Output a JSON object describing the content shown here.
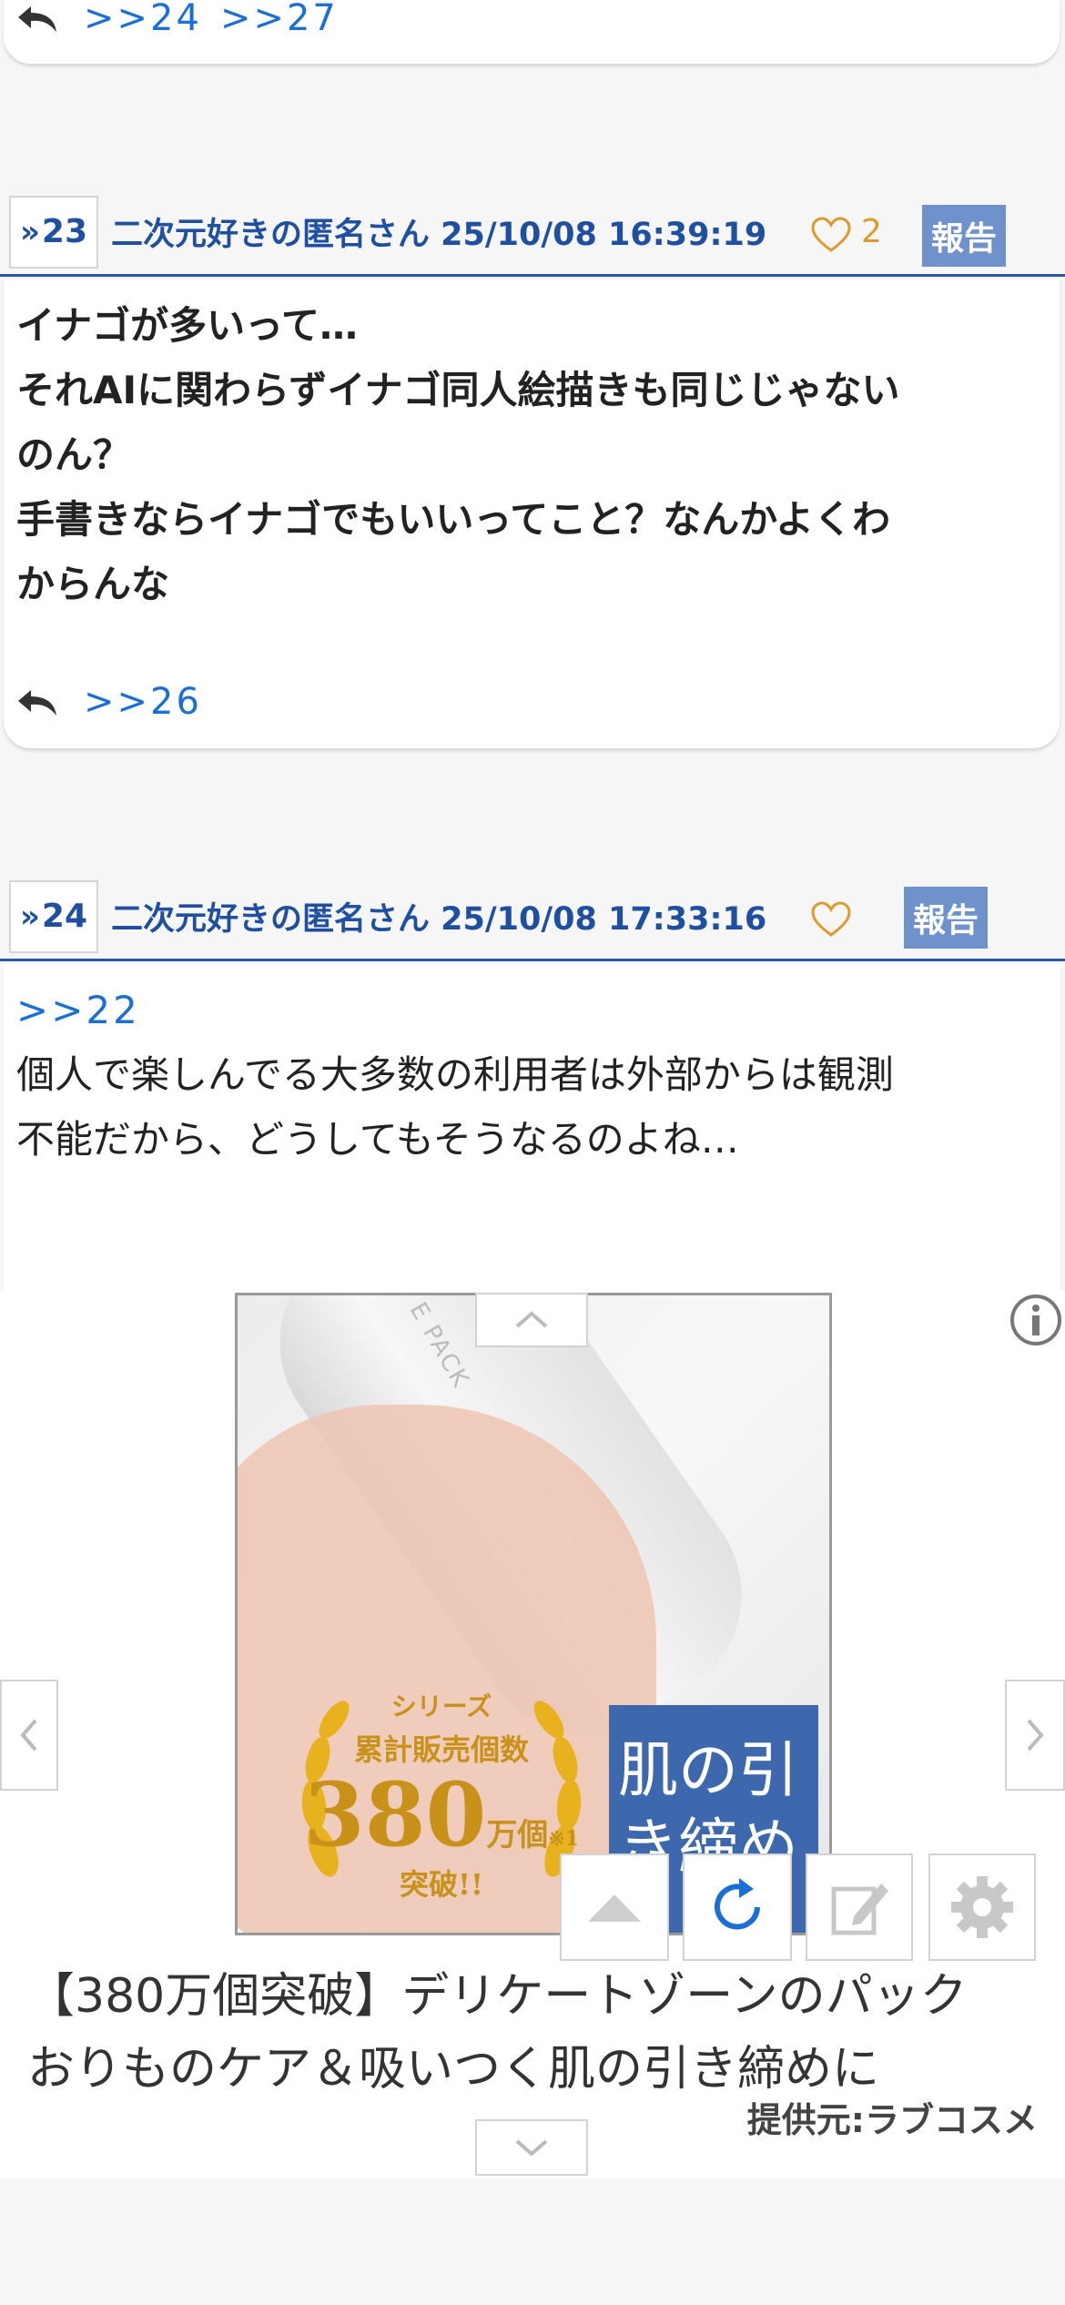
{
  "prev_card": {
    "anchors": [
      ">>24",
      ">>27"
    ]
  },
  "posts": [
    {
      "number": "23",
      "poster": "二次元好きの匿名さん 25/10/08 16:39:19",
      "likes": "2",
      "report_label": "報告",
      "body_lines": [
        "イナゴが多いって…",
        "それAIに関わらずイナゴ同人絵描きも同じじゃない",
        "のん？",
        "手書きならイナゴでもいいってこと？なんかよくわ",
        "からんな"
      ],
      "reply_anchors": [
        ">>26"
      ]
    },
    {
      "number": "24",
      "poster": "二次元好きの匿名さん 25/10/08 17:33:16",
      "likes": "",
      "report_label": "報告",
      "anchor_line": ">>22",
      "body_lines": [
        "個人で楽しんでる大多数の利用者は外部からは観測",
        "不能だから、どうしてもそうなるのよね…"
      ]
    }
  ],
  "ad": {
    "image_texts": {
      "tube_label": "E PACK",
      "badge_line1": "シリーズ",
      "badge_line2": "累計販売個数",
      "badge_number": "380",
      "badge_unit": "万個",
      "badge_note": "※1",
      "badge_line4": "突破!!",
      "tag_line1": "肌の引",
      "tag_line2": "き締め"
    },
    "headline_lines": [
      "【380万個突破】デリケートゾーンのパック",
      "おりものケア＆吸いつく肌の引き締めに"
    ],
    "provider": "提供元:ラブコスメ"
  },
  "colors": {
    "link": "#1a6fd6",
    "header_text": "#1f4fa0",
    "header_rule": "#2a56a8",
    "heart": "#e09a2c",
    "report_bg": "#6f92cc",
    "refresh_icon": "#1a6fd6"
  }
}
